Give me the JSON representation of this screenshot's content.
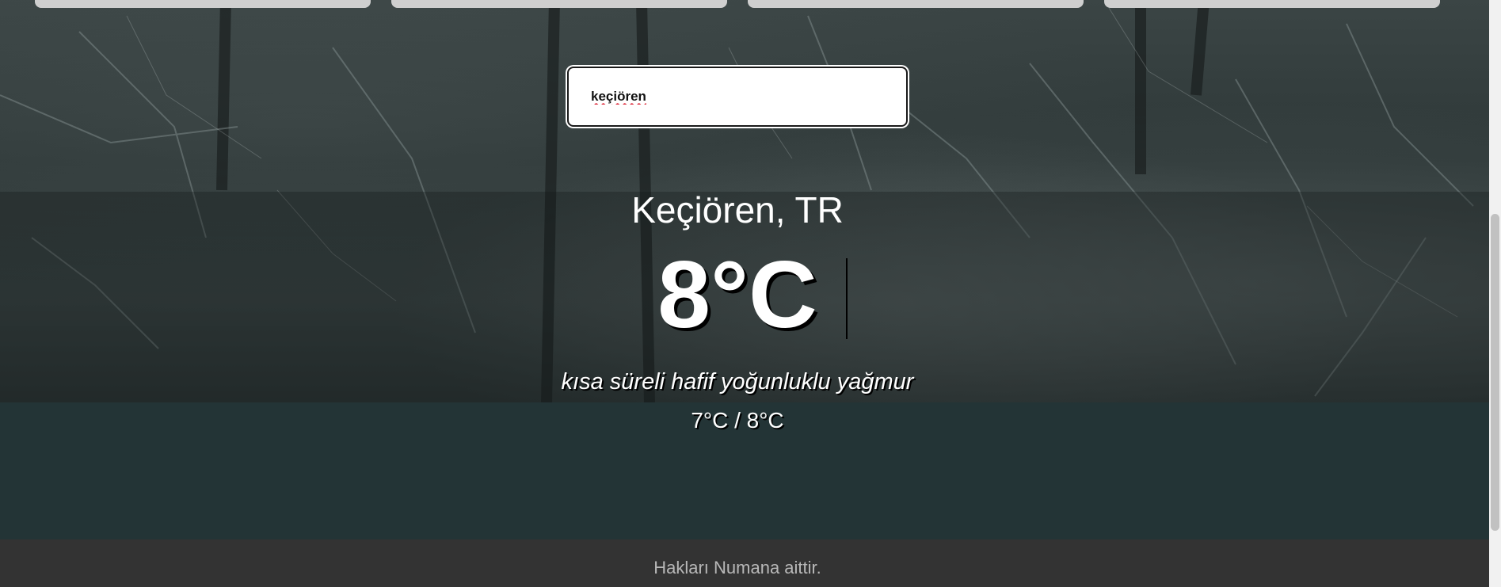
{
  "search": {
    "value": "keçiören"
  },
  "weather": {
    "location": "Keçiören, TR",
    "temperature": "8°C",
    "description": "kısa süreli hafif yoğunluklu yağmur",
    "min_max": "7°C / 8°C"
  },
  "footer": {
    "text": "Hakları Numana aittir."
  },
  "colors": {
    "content_band": "#233436",
    "footer_bg": "#333333",
    "text": "#ffffff"
  }
}
